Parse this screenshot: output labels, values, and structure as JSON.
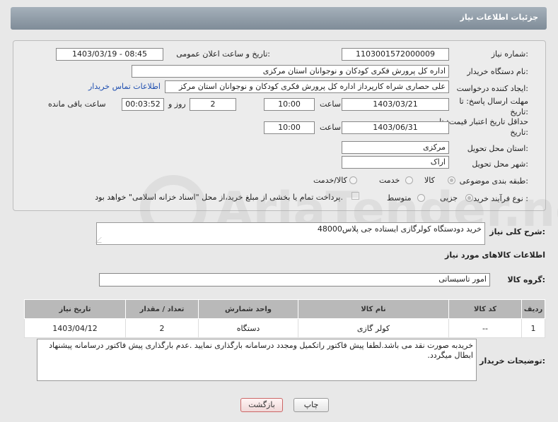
{
  "header": {
    "title": "جزئیات اطلاعات نیاز"
  },
  "form": {
    "need_number_label": "شماره نیاز:",
    "need_number": "1103001572000009",
    "announce_label": "تاریخ و ساعت اعلان عمومی:",
    "announce_value": "1403/03/19 - 08:45",
    "buyer_org_label": "نام دستگاه خریدار:",
    "buyer_org": "اداره کل پرورش فکری کودکان و نوجوانان استان مرکزی",
    "creator_label": "ایجاد کننده درخواست:",
    "creator": "علی  حصاری شراه  کارپرداز اداره کل پرورش فکری کودکان و نوجوانان استان مرکز",
    "contact_link": "اطلاعات تماس خریدار",
    "reply_deadline_label": "مهلت ارسال پاسخ: تا",
    "reply_deadline_label2": "تاریخ:",
    "reply_date": "1403/03/21",
    "time_label": "ساعت",
    "reply_time": "10:00",
    "days_value": "2",
    "days_label": "روز و",
    "remaining_value": "00:03:52",
    "remaining_label": "ساعت باقی مانده",
    "validity_label": "حداقل تاریخ اعتبار قیمت: تا",
    "validity_label2": "تاریخ:",
    "validity_date": "1403/06/31",
    "validity_time": "10:00",
    "province_label": "استان محل تحویل:",
    "province": "مرکزی",
    "city_label": "شهر محل تحویل:",
    "city": "اراک",
    "category_label": "طبقه بندی موضوعی:",
    "category_options": [
      "کالا",
      "خدمت",
      "کالا/خدمت"
    ],
    "process_label": "نوع فرآیند خرید :",
    "process_options": [
      "جزیی",
      "متوسط"
    ],
    "payment_note": "پرداخت تمام یا بخشی از مبلغ خرید،از محل \"اسناد خزانه اسلامی\" خواهد بود."
  },
  "summary": {
    "label": "شرح کلی نیاز:",
    "value": "خرید دودستگاه کولرگازی ایستاده جی پلاس48000"
  },
  "goods": {
    "section_title": "اطلاعات کالاهای مورد نیاز",
    "group_label": "گروه کالا:",
    "group_value": "امور تاسیساتی",
    "columns": [
      "ردیف",
      "کد کالا",
      "نام کالا",
      "واحد شمارش",
      "تعداد / مقدار",
      "تاریخ نیاز"
    ],
    "rows": [
      {
        "row": "1",
        "code": "--",
        "name": "کولر گازی",
        "unit": "دستگاه",
        "qty": "2",
        "date": "1403/04/12"
      }
    ]
  },
  "buyer_notes": {
    "label": "توضیحات خریدار:",
    "value": "خریدبه صورت نقد می باشد.لطفا پیش فاکتور راتکمیل ومجدد درسامانه بارگذاری نمایید .عدم بارگذاری پیش فاکتور درسامانه پیشنهاد ابطال میگردد."
  },
  "buttons": {
    "print": "چاپ",
    "back": "بازگشت"
  },
  "watermark_text": "AriaTender.neT"
}
